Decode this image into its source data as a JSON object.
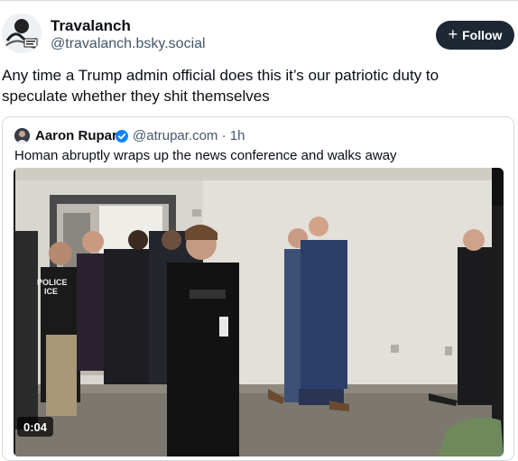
{
  "post": {
    "display_name": "Travalanch",
    "handle": "@travalanch.bsky.social",
    "follow_label": "Follow",
    "text": "Any time a Trump admin official does this it’s our patriotic duty to speculate whether they shit themselves"
  },
  "quote": {
    "author_name": "Aaron Rupar",
    "author_handle": "@atrupar.com",
    "separator": "·",
    "age": "1h",
    "text": "Homan abruptly wraps up the news conference and walks away",
    "video": {
      "duration": "0:04",
      "vest_label_line1": "POLICE",
      "vest_label_line2": "ICE"
    }
  },
  "colors": {
    "follow_bg": "#1d2833",
    "verified": "#1083fe",
    "muted_text": "#42576c",
    "border": "#d4dbe2"
  },
  "icons": {
    "plus": "plus-icon",
    "verified": "verified-badge-icon",
    "avatar": "avatar"
  }
}
